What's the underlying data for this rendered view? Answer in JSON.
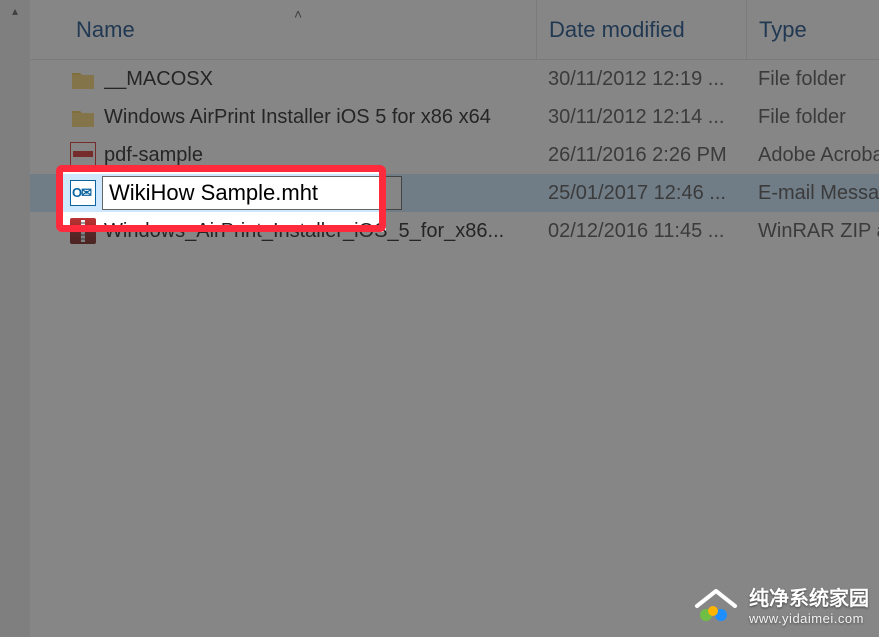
{
  "columns": {
    "name": "Name",
    "date": "Date modified",
    "type": "Type"
  },
  "rows": [
    {
      "icon": "folder",
      "name": "__MACOSX",
      "date": "30/11/2012 12:19 ...",
      "type": "File folder"
    },
    {
      "icon": "folder",
      "name": "Windows AirPrint Installer iOS 5 for x86 x64",
      "date": "30/11/2012 12:14 ...",
      "type": "File folder"
    },
    {
      "icon": "pdf",
      "name": "pdf-sample",
      "date": "26/11/2016 2:26 PM",
      "type": "Adobe Acroba"
    },
    {
      "icon": "outlook",
      "name": "WikiHow Sample.mht",
      "date": "25/01/2017 12:46 ...",
      "type": "E-mail Messa",
      "selected": true,
      "renaming": true
    },
    {
      "icon": "zip",
      "name": "Windows_AirPrint_Installer_iOS_5_for_x86...",
      "date": "02/12/2016 11:45 ...",
      "type": "WinRAR ZIP a"
    }
  ],
  "rename_value": "WikiHow Sample.mht",
  "watermark": {
    "title": "纯净系统家园",
    "url": "www.yidaimei.com"
  }
}
